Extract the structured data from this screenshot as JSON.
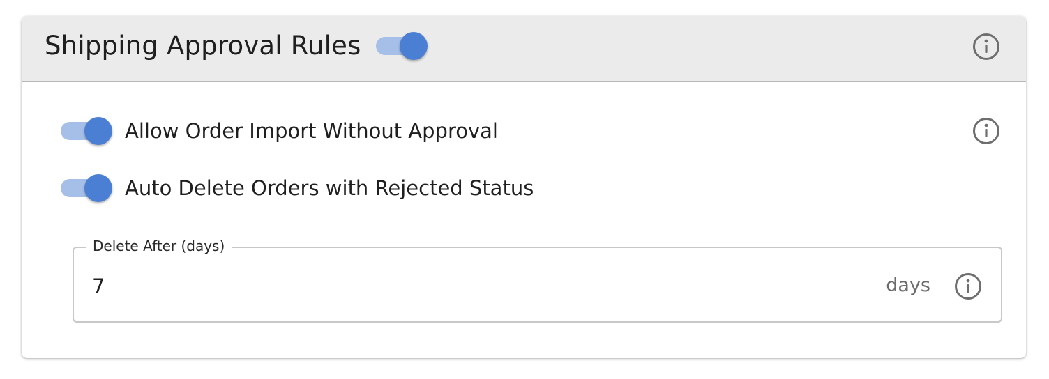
{
  "card": {
    "title": "Shipping Approval Rules",
    "enabled": true,
    "info_icon": "info-circle-icon"
  },
  "settings": [
    {
      "label": "Allow Order Import Without Approval",
      "enabled": true,
      "info_icon": "info-circle-icon"
    },
    {
      "label": "Auto Delete Orders with Rejected Status",
      "enabled": true
    }
  ],
  "delete_after": {
    "label": "Delete After (days)",
    "value": "7",
    "suffix": "days",
    "info_icon": "info-circle-icon"
  },
  "colors": {
    "toggle_thumb": "#4a7fd4",
    "toggle_track": "#a6bfe8",
    "header_bg": "#ebebeb"
  }
}
